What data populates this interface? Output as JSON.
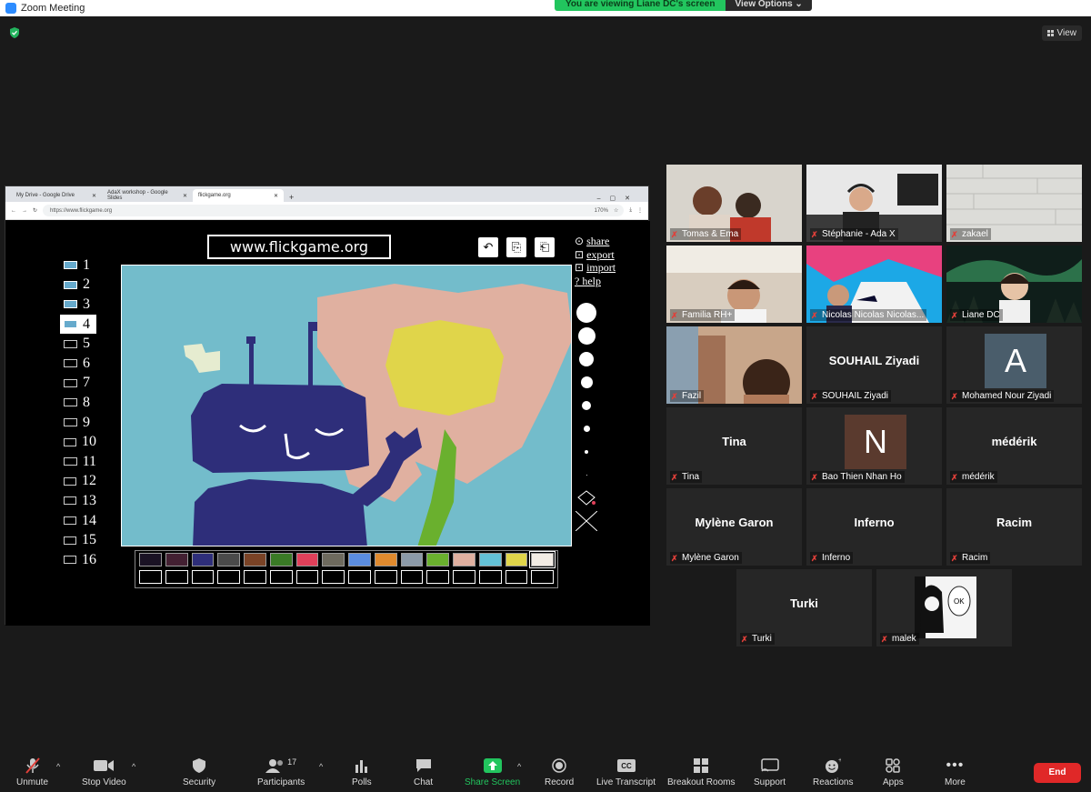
{
  "window": {
    "title": "Zoom Meeting"
  },
  "banner": {
    "viewing": "You are viewing Liane DC's screen",
    "view_options": "View Options ⌄"
  },
  "view_button": "View",
  "browser": {
    "tabs": [
      "My Drive - Google Drive",
      "AdaX workshop - Google Slides",
      "flickgame.org"
    ],
    "url": "https://www.flickgame.org",
    "zoom": "170%"
  },
  "flickgame": {
    "title": "www.flickgame.org",
    "menu": [
      "share",
      "export",
      "import",
      "? help"
    ],
    "frames": [
      "1",
      "2",
      "3",
      "4",
      "5",
      "6",
      "7",
      "8",
      "9",
      "10",
      "11",
      "12",
      "13",
      "14",
      "15",
      "16"
    ],
    "selected_frame": 4,
    "palette": [
      "#1a1224",
      "#432032",
      "#2e2e7a",
      "#4a4a4a",
      "#7a4326",
      "#3a7a26",
      "#e0405a",
      "#6e6a5e",
      "#5b8de0",
      "#e08a2e",
      "#8c9aa8",
      "#6ab02e",
      "#e0b0a0",
      "#63c1d6",
      "#e0d54a",
      "#f2ece4"
    ]
  },
  "participants": [
    {
      "name": "Tomas & Ema",
      "type": "video"
    },
    {
      "name": "Stéphanie - Ada X",
      "type": "video"
    },
    {
      "name": "zakael",
      "type": "video"
    },
    {
      "name": "Familia RH+",
      "type": "video"
    },
    {
      "name": "Nicolas Nicolas Nicolas...",
      "type": "video"
    },
    {
      "name": "Liane DC",
      "type": "video"
    },
    {
      "name": "Fazil",
      "type": "video"
    },
    {
      "name": "SOUHAIL  Ziyadi",
      "label": "SOUHAIL  Ziyadi",
      "type": "name"
    },
    {
      "name": "Mohamed Nour Ziyadi",
      "letter": "A",
      "color": "#4a5d6b",
      "type": "letter"
    },
    {
      "name": "Tina",
      "label": "Tina",
      "type": "name"
    },
    {
      "name": "Bao Thien Nhan Ho",
      "letter": "N",
      "color": "#5a3a2e",
      "type": "letter"
    },
    {
      "name": "médérik",
      "label": "médérik",
      "type": "name"
    },
    {
      "name": "Mylène Garon",
      "label": "Mylène Garon",
      "type": "name"
    },
    {
      "name": "Inferno",
      "label": "Inferno",
      "type": "name"
    },
    {
      "name": "Racim",
      "label": "Racim",
      "type": "name"
    },
    {
      "name": "Turki",
      "label": "Turki",
      "type": "name"
    },
    {
      "name": "malek",
      "type": "manga"
    }
  ],
  "toolbar": {
    "unmute": "Unmute",
    "stop_video": "Stop Video",
    "security": "Security",
    "participants": "Participants",
    "participants_count": "17",
    "polls": "Polls",
    "chat": "Chat",
    "share_screen": "Share Screen",
    "record": "Record",
    "live_transcript": "Live Transcript",
    "breakout_rooms": "Breakout Rooms",
    "support": "Support",
    "reactions": "Reactions",
    "apps": "Apps",
    "more": "More",
    "end": "End"
  }
}
